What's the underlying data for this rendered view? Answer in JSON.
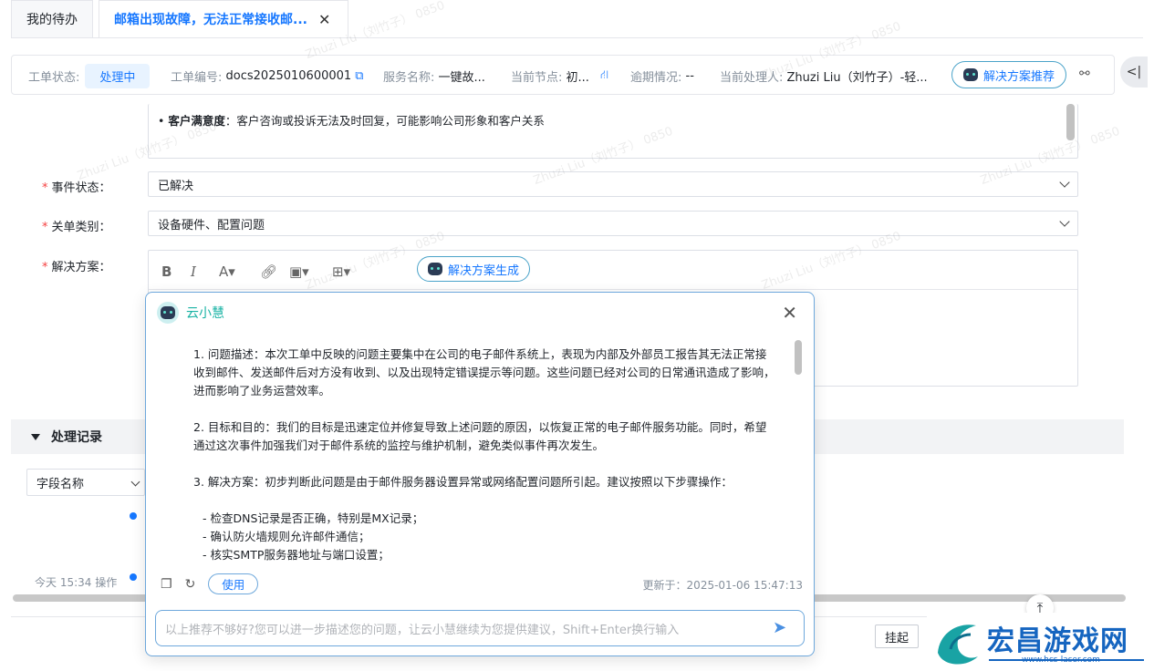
{
  "tabs": [
    {
      "label": "我的待办"
    },
    {
      "label": "邮箱出现故障，无法正常接收邮..."
    }
  ],
  "infobar": {
    "status_key": "工单状态:",
    "status_value": "处理中",
    "ticket_key": "工单编号:",
    "ticket_value": "docs2025010600001",
    "service_key": "服务名称:",
    "service_value": "一键故...",
    "node_key": "当前节点:",
    "node_value": "初...",
    "overdue_key": "逾期情况:",
    "overdue_value": "--",
    "handler_key": "当前处理人:",
    "handler_value": "Zhuzi Liu（刘竹子）-轻...",
    "recommend_button": "解决方案推荐"
  },
  "form": {
    "impact_text_label": "客户满意度",
    "impact_text": "：客户咨询或投诉无法及时回复，可能影响公司形象和客户关系",
    "event_status_label": "事件状态：",
    "event_status_value": "已解决",
    "close_category_label": "关单类别：",
    "close_category_value": "设备硬件、配置问题",
    "solution_label": "解决方案：",
    "generate_button": "解决方案生成"
  },
  "section": {
    "title": "处理记录"
  },
  "side": {
    "field_select": "字段名称",
    "timeline_text": "今天 15:34 操作"
  },
  "popup": {
    "title": "云小慧",
    "paragraphs": [
      "1. 问题描述：本次工单中反映的问题主要集中在公司的电子邮件系统上，表现为内部及外部员工报告其无法正常接收到邮件、发送邮件后对方没有收到、以及出现特定错误提示等问题。这些问题已经对公司的日常通讯造成了影响，进而影响了业务运营效率。",
      "2. 目标和目的：我们的目标是迅速定位并修复导致上述问题的原因，以恢复正常的电子邮件服务功能。同时，希望通过这次事件加强我们对于邮件系统的监控与维护机制，避免类似事件再次发生。",
      "3. 解决方案：初步判断此问题是由于邮件服务器设置异常或网络配置问题所引起。建议按照以下步骤操作："
    ],
    "steps": [
      "- 检查DNS记录是否正确，特别是MX记录；",
      "- 确认防火墙规则允许邮件通信；",
      "- 核实SMTP服务器地址与端口设置；"
    ],
    "use_button": "使用",
    "updated": "更新于：2025-01-06 15:47:13",
    "input_placeholder": "以上推荐不够好?您可以进一步描述您的问题，让云小慧继续为您提供建议，Shift+Enter换行输入"
  },
  "footer": {
    "hangup_button": "挂起"
  },
  "logo": {
    "text": "宏昌游戏网",
    "url": "www.hcs-laser.com"
  },
  "watermark": "Zhuzi Liu（刘竹子） 0850"
}
